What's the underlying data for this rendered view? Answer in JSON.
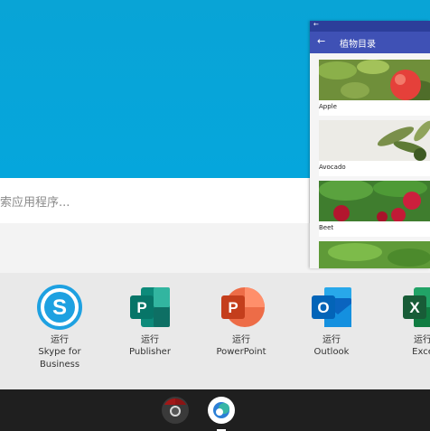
{
  "search": {
    "placeholder": "索应用程序..."
  },
  "apps": [
    {
      "run": "运行",
      "name_line1": "Skype for",
      "name_line2": "Business",
      "icon": "skype-icon",
      "color": "#1ea1e1"
    },
    {
      "run": "运行",
      "name_line1": "Publisher",
      "name_line2": "",
      "icon": "publisher-icon",
      "color": "#077568"
    },
    {
      "run": "运行",
      "name_line1": "PowerPoint",
      "name_line2": "",
      "icon": "powerpoint-icon",
      "color": "#d24726"
    },
    {
      "run": "运行",
      "name_line1": "Outlook",
      "name_line2": "",
      "icon": "outlook-icon",
      "color": "#0a64bf"
    },
    {
      "run": "运行",
      "name_line1": "Exce",
      "name_line2": "",
      "icon": "excel-icon",
      "color": "#1d7145"
    }
  ],
  "window": {
    "title": "植物目录",
    "items": [
      {
        "label": "Apple"
      },
      {
        "label": "Avocado"
      },
      {
        "label": "Beet"
      },
      {
        "label": ""
      }
    ]
  },
  "colors": {
    "hero": "#05a6dc",
    "appbar": "#3f51b5",
    "taskbar": "#1f1f1f"
  }
}
